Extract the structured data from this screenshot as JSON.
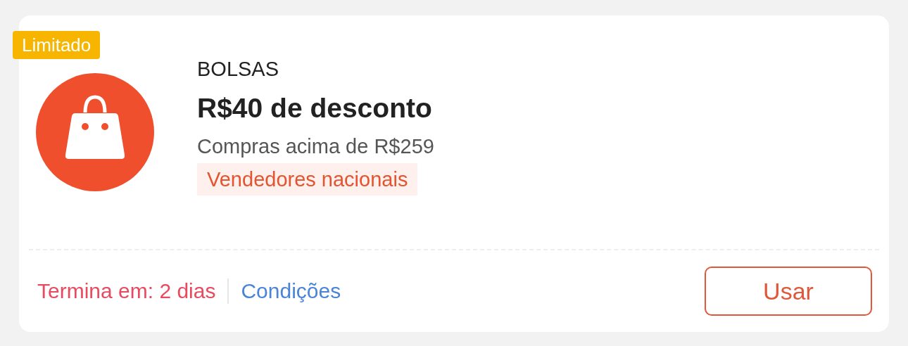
{
  "coupon": {
    "badge": "Limitado",
    "category": "BOLSAS",
    "title": "R$40 de desconto",
    "condition": "Compras acima de R$259",
    "tag": "Vendedores nacionais",
    "expiry": "Termina em: 2 dias",
    "terms_link": "Condições",
    "button": "Usar"
  }
}
